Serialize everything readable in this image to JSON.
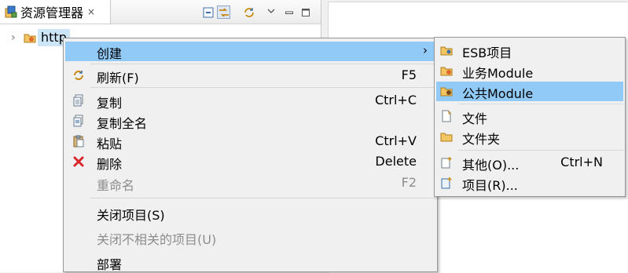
{
  "view": {
    "tab_title": "资源管理器",
    "tab_close": "×",
    "toolbar": [
      {
        "name": "collapse-all-icon"
      },
      {
        "name": "link-with-editor-icon"
      },
      {
        "name": "sync-icon"
      },
      {
        "name": "view-menu-icon"
      },
      {
        "name": "minimize-icon"
      },
      {
        "name": "maximize-icon"
      }
    ]
  },
  "tree": {
    "expander": "›",
    "item_label": "http"
  },
  "context_menu": {
    "create": {
      "label": "创建",
      "arrow": "›"
    },
    "refresh": {
      "label": "刷新(F)",
      "accel": "F5",
      "icon": "refresh-icon"
    },
    "copy": {
      "label": "复制",
      "accel": "Ctrl+C",
      "icon": "copy-icon"
    },
    "copy_qualified": {
      "label": "复制全名",
      "icon": "copy-qualified-icon"
    },
    "paste": {
      "label": "粘贴",
      "accel": "Ctrl+V",
      "icon": "paste-icon"
    },
    "delete": {
      "label": "删除",
      "accel": "Delete",
      "icon": "delete-icon",
      "color": "#d9252b"
    },
    "rename": {
      "label": "重命名",
      "accel": "F2"
    },
    "close_project": {
      "label": "关闭项目(S)"
    },
    "close_unrelated": {
      "label": "关闭不相关的项目(U)"
    },
    "deploy": {
      "label": "部署"
    }
  },
  "submenu": {
    "esb_project": {
      "label": "ESB项目",
      "icon": "folder-icon"
    },
    "business_module": {
      "label": "业务Module",
      "icon": "business-module-icon"
    },
    "public_module": {
      "label": "公共Module",
      "icon": "public-module-icon"
    },
    "file": {
      "label": "文件",
      "icon": "file-icon"
    },
    "folder": {
      "label": "文件夹",
      "icon": "folder-icon"
    },
    "other": {
      "label": "其他(O)...",
      "accel": "Ctrl+N",
      "icon": "new-wizard-icon"
    },
    "project": {
      "label": "项目(R)...",
      "icon": "new-project-icon"
    }
  },
  "colors": {
    "highlight": "#91c9f7",
    "selection": "#cde6f7",
    "menu_bg": "#f0f0f0",
    "disabled_text": "#8d8d8d"
  }
}
